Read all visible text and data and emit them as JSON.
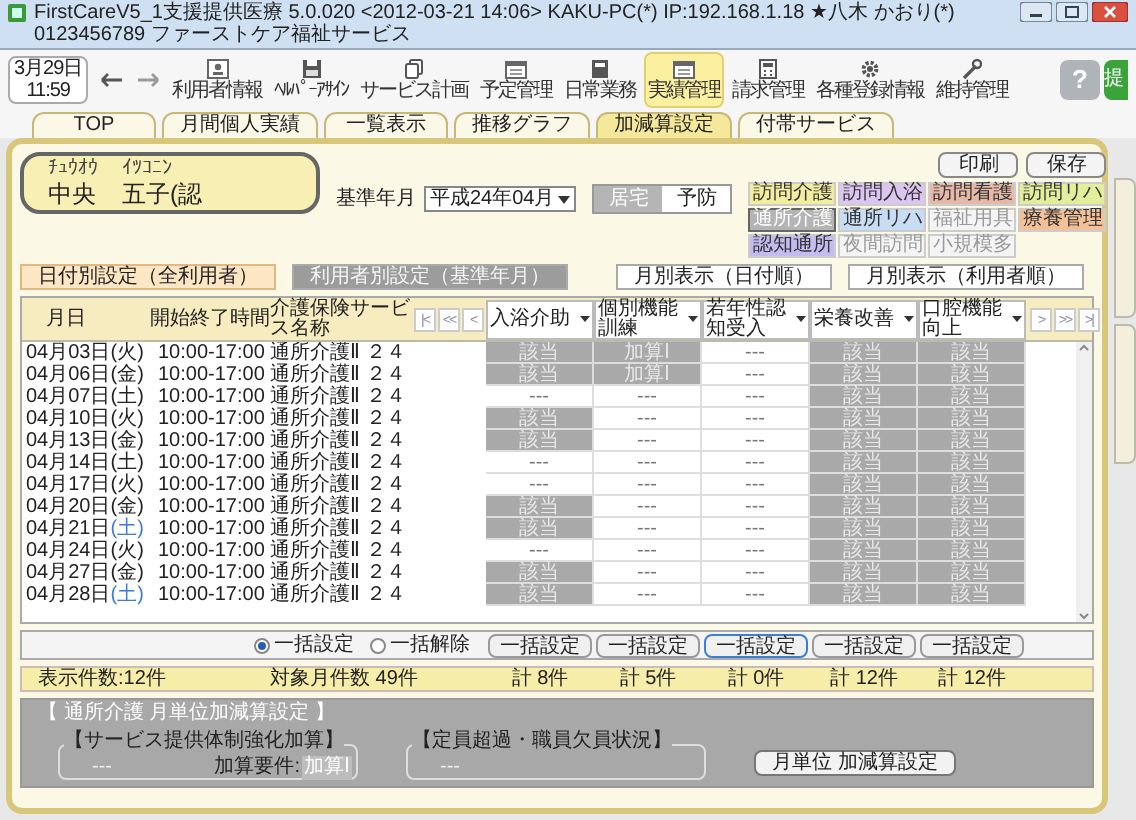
{
  "window": {
    "title": "FirstCareV5_1支援提供医療 5.0.020 <2012-03-21 14:06> KAKU-PC(*) IP:192.168.1.18 ★八木 かおり(*) 0123456789 ファーストケア福祉サービス"
  },
  "clock": {
    "date": "3月29日",
    "time": "11:59"
  },
  "toolbar": [
    {
      "label": "利用者情報",
      "kind": "card",
      "selected": false
    },
    {
      "label": "ﾍﾙﾊﾟｰｱｻｲﾝ",
      "kind": "disk",
      "selected": false
    },
    {
      "label": "サービス計画",
      "kind": "copy",
      "selected": false
    },
    {
      "label": "予定管理",
      "kind": "calendar",
      "selected": false
    },
    {
      "label": "日常業務",
      "kind": "book",
      "selected": false
    },
    {
      "label": "実績管理",
      "kind": "calendar",
      "selected": true
    },
    {
      "label": "請求管理",
      "kind": "calculator",
      "selected": false
    },
    {
      "label": "各種登録情報",
      "kind": "gear",
      "selected": false
    },
    {
      "label": "維持管理",
      "kind": "wrench",
      "selected": false
    }
  ],
  "help_button": "?",
  "extra_button": "提",
  "tabs": [
    {
      "label": "TOP",
      "selected": false
    },
    {
      "label": "月間個人実績",
      "selected": false
    },
    {
      "label": "一覧表示",
      "selected": false
    },
    {
      "label": "推移グラフ",
      "selected": false
    },
    {
      "label": "加減算設定",
      "selected": true
    },
    {
      "label": "付帯サービス",
      "selected": false
    }
  ],
  "patient": {
    "family_kana": "ﾁｭｳｵｳ",
    "family": "中央",
    "given_kana": "ｲﾂｺﾆﾝ",
    "given": "五子(認"
  },
  "base_month": {
    "label": "基準年月",
    "value": "平成24年04月"
  },
  "care_type": [
    {
      "label": "居宅",
      "selected": false
    },
    {
      "label": "予防",
      "selected": true
    }
  ],
  "actions": [
    "印刷",
    "保存"
  ],
  "services": [
    {
      "label": "訪問介護",
      "color": "#f3eda0",
      "disabled": false,
      "selected": false
    },
    {
      "label": "訪問入浴",
      "color": "#dcc6f0",
      "disabled": false,
      "selected": false
    },
    {
      "label": "訪問看護",
      "color": "#e6b8a8",
      "disabled": false,
      "selected": false
    },
    {
      "label": "訪問リハ",
      "color": "#e2ee9c",
      "disabled": false,
      "selected": false
    },
    {
      "label": "通所介護",
      "color": "#b4b4b4",
      "disabled": false,
      "selected": true
    },
    {
      "label": "通所リハ",
      "color": "#c8dcf4",
      "disabled": false,
      "selected": false
    },
    {
      "label": "福祉用具",
      "color": "#f4f4f4",
      "disabled": true,
      "selected": false
    },
    {
      "label": "療養管理",
      "color": "#f4c098",
      "disabled": false,
      "selected": false
    },
    {
      "label": "認知通所",
      "color": "#c4bcf0",
      "disabled": false,
      "selected": false
    },
    {
      "label": "夜間訪問",
      "color": "#f4f4f4",
      "disabled": true,
      "selected": false
    },
    {
      "label": "小規模多",
      "color": "#f4f4f4",
      "disabled": true,
      "selected": false
    }
  ],
  "modes": [
    {
      "label": "日付別設定（全利用者）",
      "selected": true,
      "disabled": false
    },
    {
      "label": "利用者別設定（基準年月）",
      "selected": false,
      "disabled": true
    }
  ],
  "views": [
    "月別表示（日付順）",
    "月別表示（利用者順）"
  ],
  "grid": {
    "date_header": "月日",
    "time_header": "開始終了時間",
    "service_header": "介護保険サービス名称",
    "nav_left": [
      "|<",
      "<<",
      "<"
    ],
    "nav_right": [
      ">",
      ">>",
      ">|"
    ],
    "columns": [
      "入浴介助",
      "個別機能訓練",
      "若年性認知受入",
      "栄養改善",
      "口腔機能向上"
    ],
    "rows": [
      {
        "date": "04月03日",
        "weekday": "(火)",
        "highlight": false,
        "time": "10:00-17:00",
        "service": "通所介護Ⅱ ２４",
        "cells": [
          {
            "text": "該当",
            "on": true
          },
          {
            "text": "加算Ⅰ",
            "on": true
          },
          {
            "text": "---",
            "on": false
          },
          {
            "text": "該当",
            "on": true
          },
          {
            "text": "該当",
            "on": true
          }
        ]
      },
      {
        "date": "04月06日",
        "weekday": "(金)",
        "highlight": false,
        "time": "10:00-17:00",
        "service": "通所介護Ⅱ ２４",
        "cells": [
          {
            "text": "該当",
            "on": true
          },
          {
            "text": "加算Ⅰ",
            "on": true
          },
          {
            "text": "---",
            "on": false
          },
          {
            "text": "該当",
            "on": true
          },
          {
            "text": "該当",
            "on": true
          }
        ]
      },
      {
        "date": "04月07日",
        "weekday": "(土)",
        "highlight": false,
        "time": "10:00-17:00",
        "service": "通所介護Ⅱ ２４",
        "cells": [
          {
            "text": "---",
            "on": false
          },
          {
            "text": "---",
            "on": false
          },
          {
            "text": "---",
            "on": false
          },
          {
            "text": "該当",
            "on": true
          },
          {
            "text": "該当",
            "on": true
          }
        ]
      },
      {
        "date": "04月10日",
        "weekday": "(火)",
        "highlight": false,
        "time": "10:00-17:00",
        "service": "通所介護Ⅱ ２４",
        "cells": [
          {
            "text": "該当",
            "on": true
          },
          {
            "text": "---",
            "on": false
          },
          {
            "text": "---",
            "on": false
          },
          {
            "text": "該当",
            "on": true
          },
          {
            "text": "該当",
            "on": true
          }
        ]
      },
      {
        "date": "04月13日",
        "weekday": "(金)",
        "highlight": false,
        "time": "10:00-17:00",
        "service": "通所介護Ⅱ ２４",
        "cells": [
          {
            "text": "該当",
            "on": true
          },
          {
            "text": "---",
            "on": false
          },
          {
            "text": "---",
            "on": false
          },
          {
            "text": "該当",
            "on": true
          },
          {
            "text": "該当",
            "on": true
          }
        ]
      },
      {
        "date": "04月14日",
        "weekday": "(土)",
        "highlight": false,
        "time": "10:00-17:00",
        "service": "通所介護Ⅱ ２４",
        "cells": [
          {
            "text": "---",
            "on": false
          },
          {
            "text": "---",
            "on": false
          },
          {
            "text": "---",
            "on": false
          },
          {
            "text": "該当",
            "on": true
          },
          {
            "text": "該当",
            "on": true
          }
        ]
      },
      {
        "date": "04月17日",
        "weekday": "(火)",
        "highlight": false,
        "time": "10:00-17:00",
        "service": "通所介護Ⅱ ２４",
        "cells": [
          {
            "text": "---",
            "on": false
          },
          {
            "text": "---",
            "on": false
          },
          {
            "text": "---",
            "on": false
          },
          {
            "text": "該当",
            "on": true
          },
          {
            "text": "該当",
            "on": true
          }
        ]
      },
      {
        "date": "04月20日",
        "weekday": "(金)",
        "highlight": false,
        "time": "10:00-17:00",
        "service": "通所介護Ⅱ ２４",
        "cells": [
          {
            "text": "該当",
            "on": true
          },
          {
            "text": "---",
            "on": false
          },
          {
            "text": "---",
            "on": false
          },
          {
            "text": "該当",
            "on": true
          },
          {
            "text": "該当",
            "on": true
          }
        ]
      },
      {
        "date": "04月21日",
        "weekday": "(土)",
        "highlight": true,
        "time": "10:00-17:00",
        "service": "通所介護Ⅱ ２４",
        "cells": [
          {
            "text": "該当",
            "on": true
          },
          {
            "text": "---",
            "on": false
          },
          {
            "text": "---",
            "on": false
          },
          {
            "text": "該当",
            "on": true
          },
          {
            "text": "該当",
            "on": true
          }
        ]
      },
      {
        "date": "04月24日",
        "weekday": "(火)",
        "highlight": false,
        "time": "10:00-17:00",
        "service": "通所介護Ⅱ ２４",
        "cells": [
          {
            "text": "---",
            "on": false
          },
          {
            "text": "---",
            "on": false
          },
          {
            "text": "---",
            "on": false
          },
          {
            "text": "該当",
            "on": true
          },
          {
            "text": "該当",
            "on": true
          }
        ]
      },
      {
        "date": "04月27日",
        "weekday": "(金)",
        "highlight": false,
        "time": "10:00-17:00",
        "service": "通所介護Ⅱ ２４",
        "cells": [
          {
            "text": "該当",
            "on": true
          },
          {
            "text": "---",
            "on": false
          },
          {
            "text": "---",
            "on": false
          },
          {
            "text": "該当",
            "on": true
          },
          {
            "text": "該当",
            "on": true
          }
        ]
      },
      {
        "date": "04月28日",
        "weekday": "(土)",
        "highlight": true,
        "time": "10:00-17:00",
        "service": "通所介護Ⅱ ２４",
        "cells": [
          {
            "text": "該当",
            "on": true
          },
          {
            "text": "---",
            "on": false
          },
          {
            "text": "---",
            "on": false
          },
          {
            "text": "該当",
            "on": true
          },
          {
            "text": "該当",
            "on": true
          }
        ]
      }
    ]
  },
  "bulk": {
    "options": [
      {
        "label": "一括設定",
        "selected": true
      },
      {
        "label": "一括解除",
        "selected": false
      }
    ],
    "buttons": [
      {
        "label": "一括設定",
        "focused": false
      },
      {
        "label": "一括設定",
        "focused": false
      },
      {
        "label": "一括設定",
        "focused": true
      },
      {
        "label": "一括設定",
        "focused": false
      },
      {
        "label": "一括設定",
        "focused": false
      }
    ]
  },
  "summary": {
    "shown": "表示件数:12件",
    "target": "対象月件数 49件",
    "totals": [
      "計 8件",
      "計 5件",
      "計 0件",
      "計 12件",
      "計 12件"
    ]
  },
  "monthly": {
    "title": "【 通所介護 月単位加減算設定 】",
    "groups": [
      {
        "title": "【サービス提供体制強化加算】",
        "value": "---",
        "requirement_label": "加算要件:",
        "requirement": "加算Ⅰ"
      },
      {
        "title": "【定員超過・職員欠員状況】",
        "value": "---"
      }
    ],
    "button": "月単位 加減算設定"
  }
}
